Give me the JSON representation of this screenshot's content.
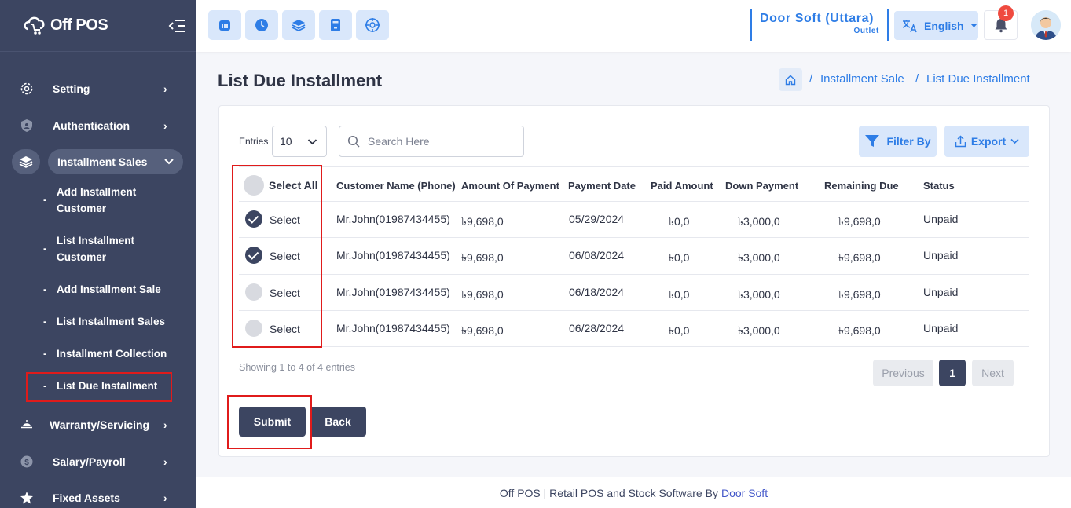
{
  "app": {
    "logo_text": "Off POS"
  },
  "sidebar": {
    "items": [
      {
        "label": "Setting"
      },
      {
        "label": "Authentication"
      },
      {
        "label": "Installment Sales"
      },
      {
        "label": "Warranty/Servicing"
      },
      {
        "label": "Salary/Payroll"
      },
      {
        "label": "Fixed Assets"
      }
    ],
    "subitems": [
      {
        "label": "Add Installment Customer"
      },
      {
        "label": "List Installment Customer"
      },
      {
        "label": "Add Installment Sale"
      },
      {
        "label": "List Installment Sales"
      },
      {
        "label": "Installment Collection"
      },
      {
        "label": "List Due Installment"
      }
    ],
    "dash": "-",
    "chevron": "›",
    "chevron_down": "⌄"
  },
  "header": {
    "outlet_name": "Door Soft (Uttara)",
    "outlet_sub": "Outlet",
    "language": "English",
    "notification_count": "1"
  },
  "page": {
    "title": "List Due Installment",
    "breadcrumb": [
      "Installment Sale",
      "List Due Installment"
    ],
    "separator": "/"
  },
  "controls": {
    "entries_label": "Entries",
    "entries_value": "10",
    "search_placeholder": "Search Here",
    "filter_label": "Filter By",
    "export_label": "Export"
  },
  "table": {
    "columns": [
      "Select All",
      "Customer Name (Phone)",
      "Amount Of Payment",
      "Payment Date",
      "Paid Amount",
      "Down Payment",
      "Remaining Due",
      "Status"
    ],
    "rows": [
      {
        "select": "Select",
        "checked": true,
        "customer": "Mr.John(01987434455)",
        "amount": "৳9,698,0",
        "date": "05/29/2024",
        "paid": "৳0,0",
        "down": "৳3,000,0",
        "remaining": "৳9,698,0",
        "status": "Unpaid"
      },
      {
        "select": "Select",
        "checked": true,
        "customer": "Mr.John(01987434455)",
        "amount": "৳9,698,0",
        "date": "06/08/2024",
        "paid": "৳0,0",
        "down": "৳3,000,0",
        "remaining": "৳9,698,0",
        "status": "Unpaid"
      },
      {
        "select": "Select",
        "checked": false,
        "customer": "Mr.John(01987434455)",
        "amount": "৳9,698,0",
        "date": "06/18/2024",
        "paid": "৳0,0",
        "down": "৳3,000,0",
        "remaining": "৳9,698,0",
        "status": "Unpaid"
      },
      {
        "select": "Select",
        "checked": false,
        "customer": "Mr.John(01987434455)",
        "amount": "৳9,698,0",
        "date": "06/28/2024",
        "paid": "৳0,0",
        "down": "৳3,000,0",
        "remaining": "৳9,698,0",
        "status": "Unpaid"
      }
    ]
  },
  "pagination": {
    "info": "Showing 1 to 4 of 4 entries",
    "previous": "Previous",
    "current": "1",
    "next": "Next"
  },
  "actions": {
    "submit": "Submit",
    "back": "Back"
  },
  "footer": {
    "text": "Off POS | Retail POS and Stock Software By",
    "link": "Door Soft"
  },
  "colors": {
    "sidebar_bg": "#3c4561",
    "accent": "#2e7de6",
    "highlight": "#e01b1b",
    "badge": "#ef4a3f"
  }
}
